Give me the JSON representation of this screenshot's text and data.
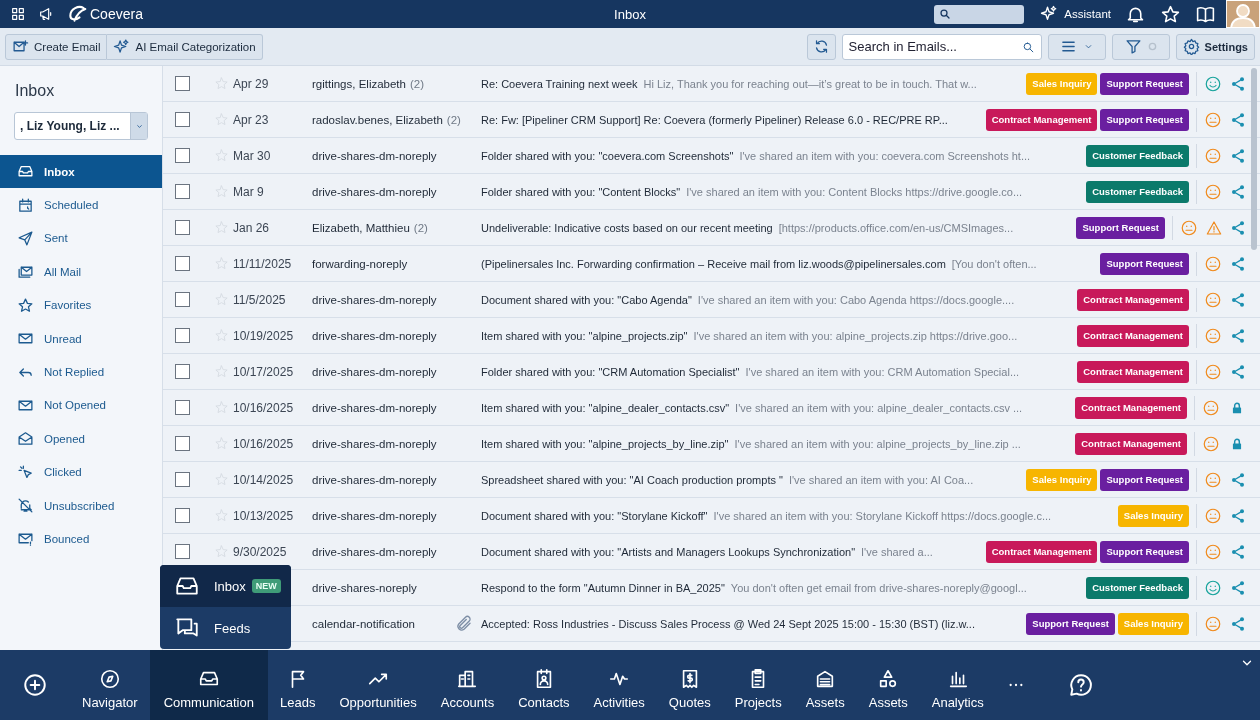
{
  "top_bar": {
    "brand": "Coevera",
    "title": "Inbox",
    "assistant": "Assistant"
  },
  "toolbar": {
    "create": "Create Email",
    "categorize": "AI Email Categorization",
    "search": {
      "placeholder": "Search in Emails..."
    },
    "settings": "Settings"
  },
  "sidebar": {
    "title": "Inbox",
    "mailbox": ", Liz Young, Liz ...",
    "items": [
      {
        "label": "Inbox",
        "selected": true
      },
      {
        "label": "Scheduled",
        "selected": false
      },
      {
        "label": "Sent",
        "selected": false
      },
      {
        "label": "All Mail",
        "selected": false
      },
      {
        "label": "Favorites",
        "selected": false
      },
      {
        "label": "Unread",
        "selected": false
      },
      {
        "label": "Not Replied",
        "selected": false
      },
      {
        "label": "Not Opened",
        "selected": false
      },
      {
        "label": "Opened",
        "selected": false
      },
      {
        "label": "Clicked",
        "selected": false
      },
      {
        "label": "Unsubscribed",
        "selected": false
      },
      {
        "label": "Bounced",
        "selected": false
      }
    ]
  },
  "emails": [
    {
      "checked": false,
      "starred": false,
      "date": "Apr 29",
      "sender": "rgittings, Elizabeth",
      "count": "(2)",
      "attachment": false,
      "subject": "Re: Coevera Training next week",
      "preview": "Hi Liz, Thank you for reaching out—it’s great to be in touch. That w...",
      "tags": [
        {
          "label": "Sales Inquiry",
          "color": "#f7b500"
        },
        {
          "label": "Support Request",
          "color": "#6a1fa0"
        }
      ],
      "positive": true,
      "warning": false,
      "locked": false
    },
    {
      "checked": false,
      "starred": false,
      "date": "Apr 23",
      "sender": "radoslav.benes, Elizabeth",
      "count": "(2)",
      "attachment": false,
      "subject": "Re: Fw: [Pipeliner CRM Support] Re: Coevera (formerly Pipeliner) Release 6.0 - REC/PRE RP...",
      "tags": [
        {
          "label": "Contract Management",
          "color": "#c8195a"
        },
        {
          "label": "Support Request",
          "color": "#6a1fa0"
        }
      ],
      "positive": false,
      "warning": false,
      "locked": false
    },
    {
      "checked": false,
      "starred": false,
      "date": "Mar 30",
      "sender": "drive-shares-dm-noreply",
      "attachment": false,
      "subject": "Folder shared with you: \"coevera.com Screenshots\"",
      "preview": "I've shared an item with you: coevera.com Screenshots ht...",
      "tags": [
        {
          "label": "Customer Feedback",
          "color": "#0b7a6b"
        }
      ],
      "positive": false,
      "warning": false,
      "locked": false
    },
    {
      "checked": false,
      "starred": false,
      "date": "Mar 9",
      "sender": "drive-shares-dm-noreply",
      "attachment": false,
      "subject": "Folder shared with you: \"Content Blocks\"",
      "preview": "I've shared an item with you: Content Blocks https://drive.google.co...",
      "tags": [
        {
          "label": "Customer Feedback",
          "color": "#0b7a6b"
        }
      ],
      "positive": false,
      "warning": false,
      "locked": false
    },
    {
      "checked": false,
      "starred": false,
      "date": "Jan 26",
      "sender": "Elizabeth, Matthieu",
      "count": "(2)",
      "attachment": false,
      "subject": "Undeliverable: Indicative costs based on our recent meeting",
      "preview": "[https://products.office.com/en-us/CMSImages...",
      "tags": [
        {
          "label": "Support Request",
          "color": "#6a1fa0"
        }
      ],
      "positive": false,
      "warning": true,
      "locked": false
    },
    {
      "checked": false,
      "starred": false,
      "date": "11/11/2025",
      "sender": "forwarding-noreply",
      "attachment": false,
      "subject": "(Pipelinersales Inc. Forwarding confirmation – Receive mail from liz.woods@pipelinersales.com",
      "preview": "[You don't often...",
      "tags": [
        {
          "label": "Support Request",
          "color": "#6a1fa0"
        }
      ],
      "positive": false,
      "warning": false,
      "locked": false
    },
    {
      "checked": false,
      "starred": false,
      "date": "11/5/2025",
      "sender": "drive-shares-dm-noreply",
      "attachment": false,
      "subject": "Document shared with you: \"Cabo Agenda\"",
      "preview": "I've shared an item with you: Cabo Agenda https://docs.google....",
      "tags": [
        {
          "label": "Contract Management",
          "color": "#c8195a"
        }
      ],
      "positive": false,
      "warning": false,
      "locked": false
    },
    {
      "checked": false,
      "starred": false,
      "date": "10/19/2025",
      "sender": "drive-shares-dm-noreply",
      "attachment": false,
      "subject": "Item shared with you: \"alpine_projects.zip\"",
      "preview": "I've shared an item with you: alpine_projects.zip https://drive.goo...",
      "tags": [
        {
          "label": "Contract Management",
          "color": "#c8195a"
        }
      ],
      "positive": false,
      "warning": false,
      "locked": false
    },
    {
      "checked": false,
      "starred": false,
      "date": "10/17/2025",
      "sender": "drive-shares-dm-noreply",
      "attachment": false,
      "subject": "Folder shared with you: \"CRM Automation Specialist\"",
      "preview": "I've shared an item with you: CRM Automation Special...",
      "tags": [
        {
          "label": "Contract Management",
          "color": "#c8195a"
        }
      ],
      "positive": false,
      "warning": false,
      "locked": false
    },
    {
      "checked": false,
      "starred": false,
      "date": "10/16/2025",
      "sender": "drive-shares-dm-noreply",
      "attachment": false,
      "subject": "Item shared with you: \"alpine_dealer_contacts.csv\"",
      "preview": "I've shared an item with you: alpine_dealer_contacts.csv ...",
      "tags": [
        {
          "label": "Contract Management",
          "color": "#c8195a"
        }
      ],
      "positive": false,
      "warning": false,
      "locked": true
    },
    {
      "checked": false,
      "starred": false,
      "date": "10/16/2025",
      "sender": "drive-shares-dm-noreply",
      "attachment": false,
      "subject": "Item shared with you: \"alpine_projects_by_line.zip\"",
      "preview": "I've shared an item with you: alpine_projects_by_line.zip ...",
      "tags": [
        {
          "label": "Contract Management",
          "color": "#c8195a"
        }
      ],
      "positive": false,
      "warning": false,
      "locked": true
    },
    {
      "checked": false,
      "starred": false,
      "date": "10/14/2025",
      "sender": "drive-shares-dm-noreply",
      "attachment": false,
      "subject": "Spreadsheet shared with you: \"AI Coach production prompts \"",
      "preview": "I've shared an item with you: AI Coa...",
      "tags": [
        {
          "label": "Sales Inquiry",
          "color": "#f7b500"
        },
        {
          "label": "Support Request",
          "color": "#6a1fa0"
        }
      ],
      "positive": false,
      "warning": false,
      "locked": false
    },
    {
      "checked": false,
      "starred": false,
      "date": "10/13/2025",
      "sender": "drive-shares-dm-noreply",
      "attachment": false,
      "subject": "Document shared with you: \"Storylane Kickoff\"",
      "preview": "I've shared an item with you: Storylane Kickoff https://docs.google.c...",
      "tags": [
        {
          "label": "Sales Inquiry",
          "color": "#f7b500"
        }
      ],
      "positive": false,
      "warning": false,
      "locked": false
    },
    {
      "checked": false,
      "starred": false,
      "date": "9/30/2025",
      "sender": "drive-shares-dm-noreply",
      "attachment": false,
      "subject": "Document shared with you: \"Artists and Managers Lookups Synchronization\"",
      "preview": "I've shared a...",
      "tags": [
        {
          "label": "Contract Management",
          "color": "#c8195a"
        },
        {
          "label": "Support Request",
          "color": "#6a1fa0"
        }
      ],
      "positive": false,
      "warning": false,
      "locked": false
    },
    {
      "sender": "drive-shares-noreply",
      "attachment": false,
      "subject": "Respond to the form \"Autumn Dinner in BA_2025\"",
      "preview": "You don't often get email from drive-shares-noreply@googl...",
      "tags": [
        {
          "label": "Customer Feedback",
          "color": "#0b7a6b"
        }
      ],
      "positive": true,
      "warning": false,
      "locked": false
    },
    {
      "sender": "calendar-notification",
      "attachment": true,
      "subject": "Accepted: Ross Industries - Discuss Sales Process @ Wed 24 Sept 2025 15:00 - 15:30 (BST) (liz.w...",
      "tags": [
        {
          "label": "Support Request",
          "color": "#6a1fa0"
        },
        {
          "label": "Sales Inquiry",
          "color": "#f7b500"
        }
      ],
      "positive": false,
      "warning": false,
      "locked": false
    }
  ],
  "popup_menu": [
    {
      "label": "Inbox",
      "badge": "NEW",
      "selected": true
    },
    {
      "label": "Feeds",
      "selected": false
    }
  ],
  "bottom_nav": [
    {
      "label": "Navigator",
      "selected": false
    },
    {
      "label": "Communication",
      "selected": true
    },
    {
      "label": "Leads",
      "selected": false
    },
    {
      "label": "Opportunities",
      "selected": false
    },
    {
      "label": "Accounts",
      "selected": false
    },
    {
      "label": "Contacts",
      "selected": false
    },
    {
      "label": "Activities",
      "selected": false
    },
    {
      "label": "Quotes",
      "selected": false
    },
    {
      "label": "Projects",
      "selected": false
    },
    {
      "label": "Assets",
      "selected": false
    },
    {
      "label": "Assets",
      "selected": false
    },
    {
      "label": "Analytics",
      "selected": false
    }
  ]
}
